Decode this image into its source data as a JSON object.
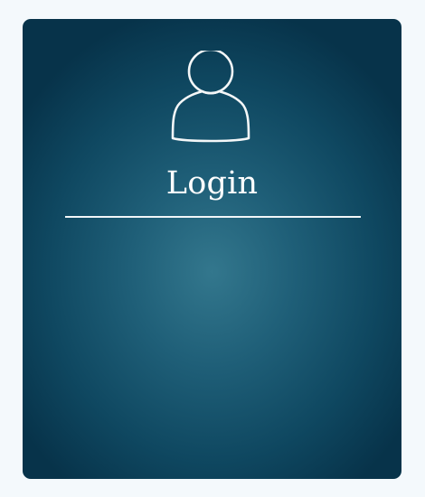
{
  "login_card": {
    "title": "Login",
    "icon": "user-icon"
  },
  "colors": {
    "page_background": "#f4f9fc",
    "card_center": "#33778d",
    "card_edge": "#07334a",
    "foreground": "#ffffff"
  }
}
